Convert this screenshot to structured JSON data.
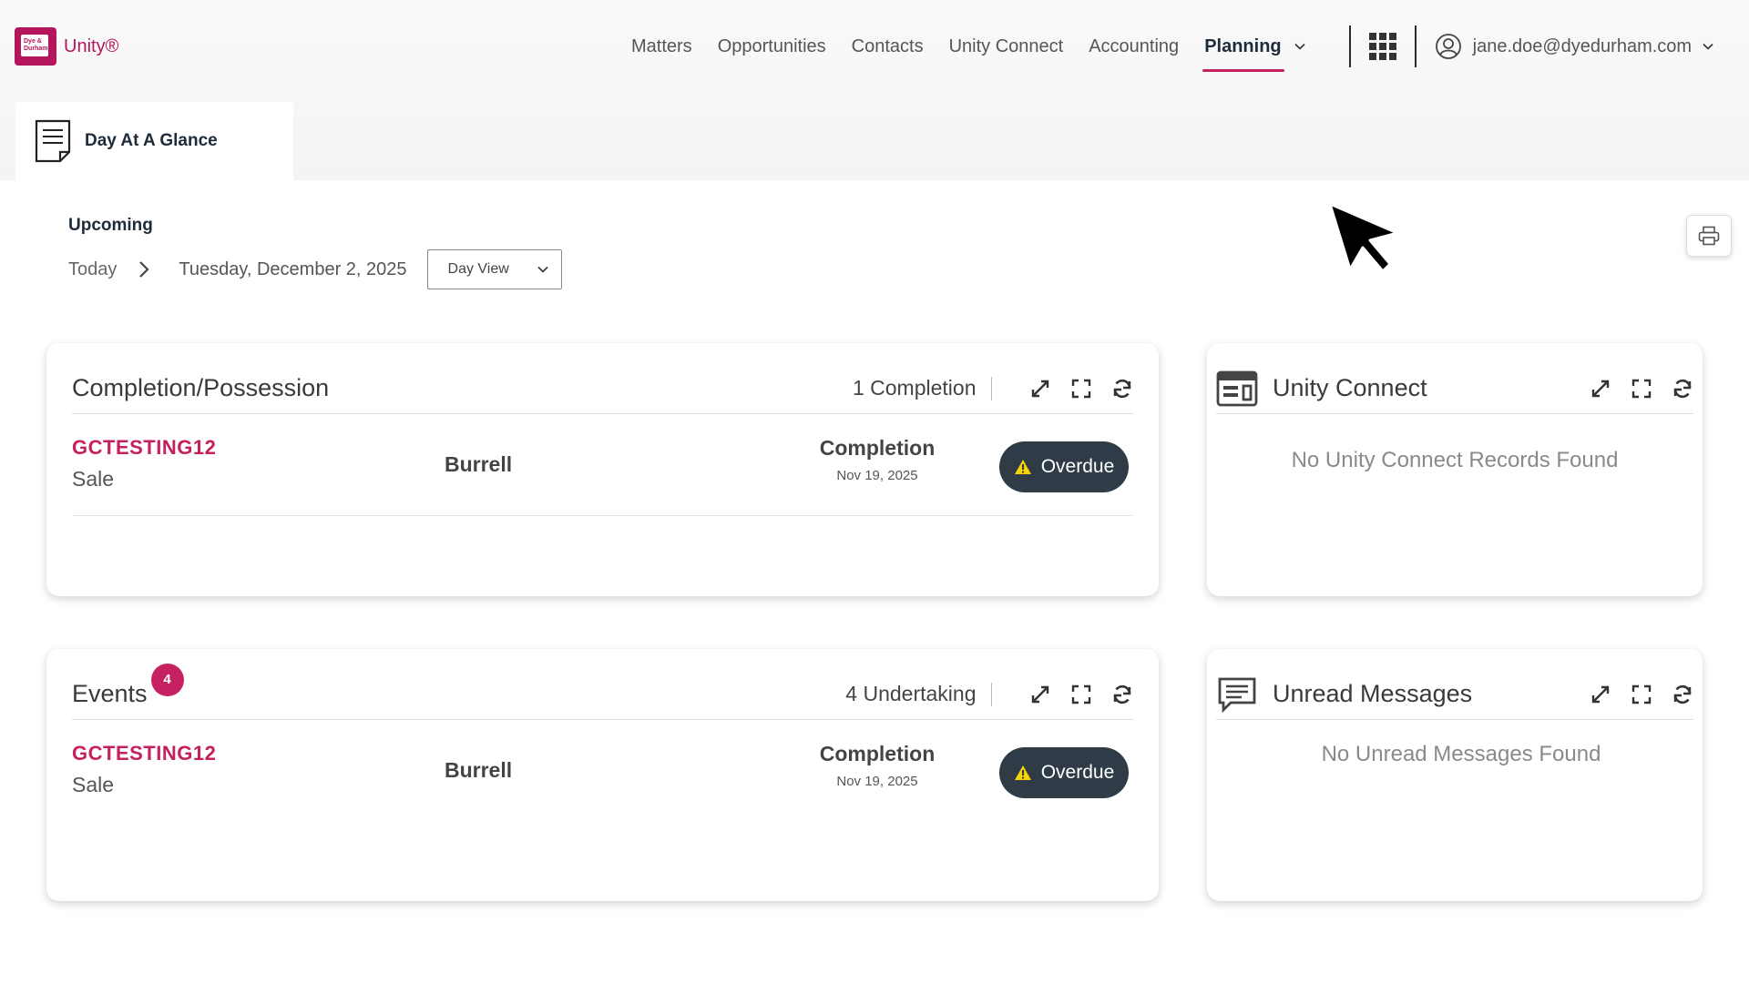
{
  "app": {
    "logo_text": "Unity®",
    "logo_mark_text": "Dye & Durham"
  },
  "nav": {
    "items": [
      "Matters",
      "Opportunities",
      "Contacts",
      "Unity Connect",
      "Accounting"
    ],
    "active": "Planning",
    "user_email": "jane.doe@dyedurham.com"
  },
  "tab": {
    "label": "Day At A Glance"
  },
  "header": {
    "section": "Upcoming",
    "today": "Today",
    "date": "Tuesday, December 2, 2025",
    "view_select": "Day View"
  },
  "completion_card": {
    "title": "Completion/Possession",
    "count": "1 Completion",
    "rows": [
      {
        "matter": "GCTESTING12",
        "type": "Sale",
        "client": "Burrell",
        "event": "Completion",
        "event_date": "Nov 19, 2025",
        "status": "Overdue"
      }
    ]
  },
  "events_card": {
    "title": "Events",
    "badge": "4",
    "count": "4 Undertaking",
    "rows": [
      {
        "matter": "GCTESTING12",
        "type": "Sale",
        "client": "Burrell",
        "event": "Completion",
        "event_date": "Nov 19, 2025",
        "status": "Overdue"
      }
    ]
  },
  "unity_connect_card": {
    "title": "Unity Connect",
    "empty": "No Unity Connect Records Found"
  },
  "messages_card": {
    "title": "Unread Messages",
    "empty": "No Unread Messages Found"
  },
  "colors": {
    "brand": "#c5205f",
    "status_pill": "#2f3b46",
    "warning": "#f5d20a"
  }
}
